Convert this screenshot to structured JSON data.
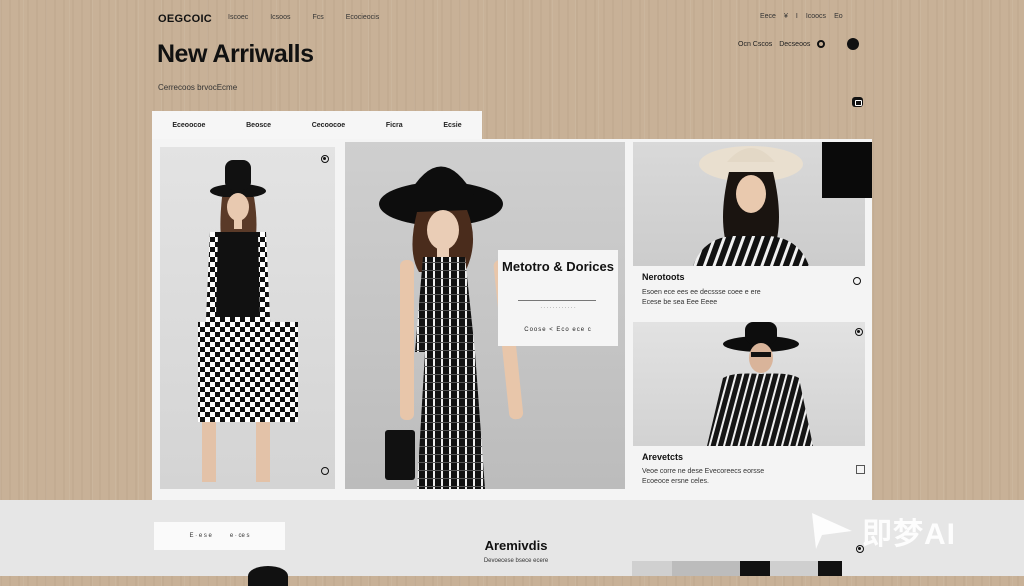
{
  "header": {
    "logo": "OEGCOIC",
    "nav": [
      "Iscoec",
      "Icsoos",
      "Fcs",
      "Ecocieocis"
    ],
    "nav_right": [
      "Eece",
      "¥",
      "I",
      "Icoocs",
      "Eo"
    ],
    "account_label": "Ocn Cscos",
    "account_sub": "Decseoos"
  },
  "page": {
    "title": "New Arriwalls",
    "subtitle": "Cerrecoos brvocEcme"
  },
  "filters": [
    "Eceoocoe",
    "Beosce",
    "Cecoocoe",
    "Ficra",
    "Ecsie"
  ],
  "overlay": {
    "title": "Metotro & Dorices",
    "small_text": "· · · · · · · · · · · ·",
    "meta": "Coose   <   Eco ece   c"
  },
  "product_cards": [
    {
      "title": "Nerotoots",
      "desc_line1": "Esoen ece ees ee decssse coee e ere",
      "desc_line2": "Ecese be sea Eee Eeee"
    },
    {
      "title": "Arevetcts",
      "desc_line1": "Veoe corre ne dese Evecoreecs eorsse",
      "desc_line2": "Ecoeoce ersne celes."
    }
  ],
  "lower": {
    "pill_items": [
      "E · e  s  e",
      "e · ce  s"
    ],
    "title": "Aremivdis",
    "subtitle": "Devoecese bsece ecere"
  },
  "watermark": "即梦AI",
  "colors": {
    "background": "#c8b197",
    "panel": "#f4f4f4",
    "accent": "#111111"
  }
}
